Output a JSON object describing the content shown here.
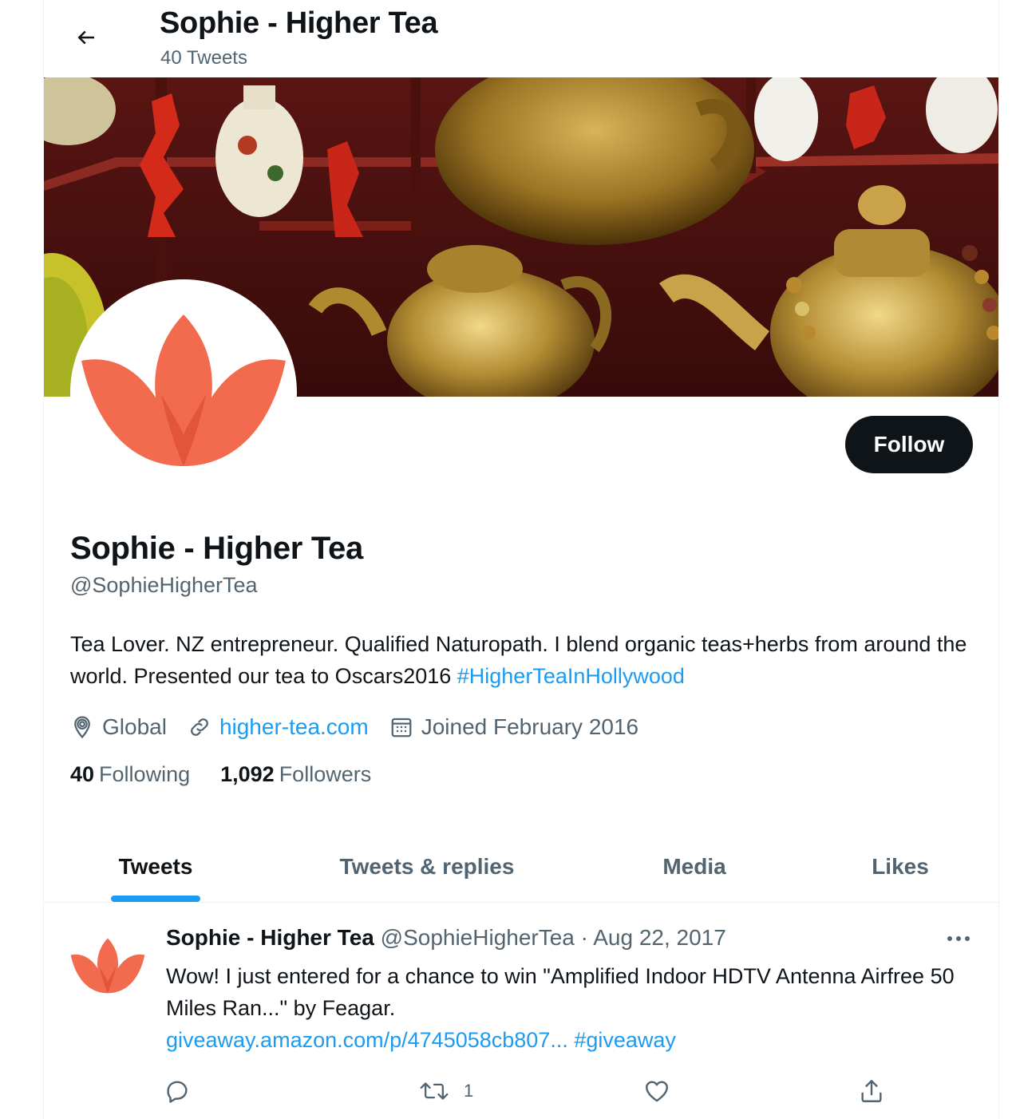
{
  "header": {
    "title": "Sophie - Higher Tea",
    "tweet_count": "40 Tweets"
  },
  "profile": {
    "name": "Sophie - Higher Tea",
    "handle": "@SophieHigherTea",
    "follow_label": "Follow",
    "bio_text": "Tea Lover. NZ entrepreneur. Qualified Naturopath. I blend organic teas+herbs from around the world. Presented our tea to Oscars2016 ",
    "bio_hashtag": "#HigherTeaInHollywood",
    "location": "Global",
    "website": "higher-tea.com",
    "joined": "Joined February 2016",
    "following_count": "40",
    "following_label": "Following",
    "followers_count": "1,092",
    "followers_label": "Followers",
    "avatar_color": "#f26b4f"
  },
  "tabs": [
    {
      "label": "Tweets",
      "active": true
    },
    {
      "label": "Tweets & replies",
      "active": false
    },
    {
      "label": "Media",
      "active": false
    },
    {
      "label": "Likes",
      "active": false
    }
  ],
  "tweet": {
    "name": "Sophie - Higher Tea",
    "handle": "@SophieHigherTea",
    "separator": "·",
    "date": "Aug 22, 2017",
    "text": "Wow! I just entered for a chance to win \"Amplified Indoor HDTV Antenna Airfree 50 Miles Ran...\" by Feagar.",
    "link": "giveaway.amazon.com/p/4745058cb807...",
    "hashtag": "#giveaway",
    "retweet_count": "1"
  },
  "colors": {
    "accent": "#1d9bf0",
    "text": "#0f1419",
    "secondary": "#536471"
  }
}
